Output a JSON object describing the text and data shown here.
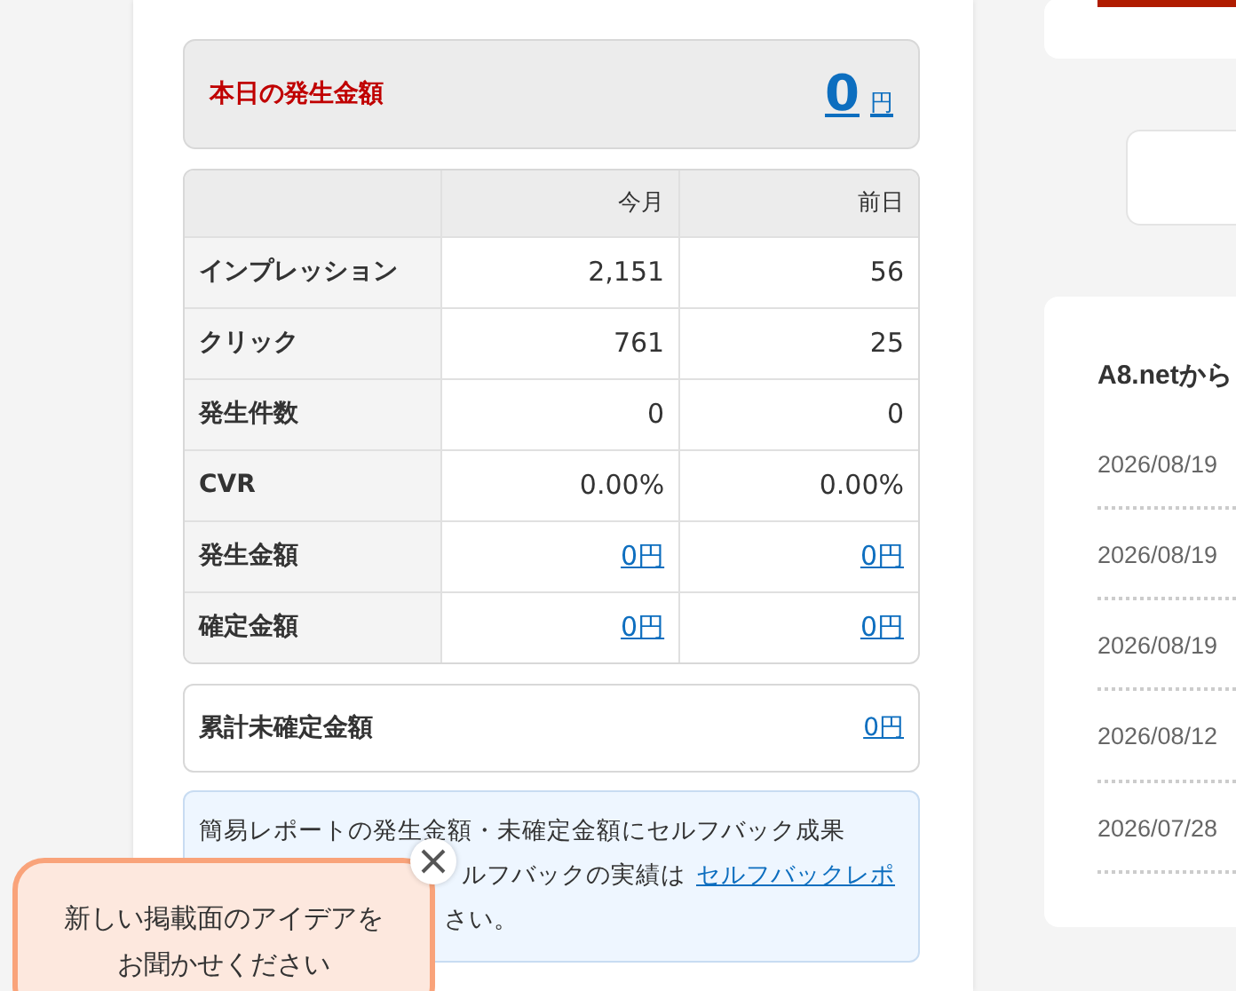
{
  "today": {
    "label": "本日の発生金額",
    "amount": "0",
    "unit": "円"
  },
  "report_table": {
    "columns": [
      "今月",
      "前日"
    ],
    "rows": [
      {
        "label": "インプレッション",
        "kind": "text",
        "values": [
          "2,151",
          "56"
        ]
      },
      {
        "label": "クリック",
        "kind": "text",
        "values": [
          "761",
          "25"
        ]
      },
      {
        "label": "発生件数",
        "kind": "text",
        "values": [
          "0",
          "0"
        ]
      },
      {
        "label": "CVR",
        "kind": "text",
        "values": [
          "0.00%",
          "0.00%"
        ]
      },
      {
        "label": "発生金額",
        "kind": "link",
        "values": [
          "0円",
          "0円"
        ]
      },
      {
        "label": "確定金額",
        "kind": "link",
        "values": [
          "0円",
          "0円"
        ]
      }
    ]
  },
  "unconfirmed_total": {
    "label": "累計未確定金額",
    "value": "0円"
  },
  "notice": {
    "line_1": "簡易レポートの発生金額・未確定金額にセルフバック成果",
    "line_2": "ルフバックの実績は",
    "link": "セルフバックレポ",
    "line_3": "さい。"
  },
  "sidebar": {
    "news_title": "A8.netから",
    "news_dates": [
      "2026/08/19",
      "2026/08/19",
      "2026/08/19",
      "2026/08/12",
      "2026/07/28"
    ]
  },
  "feedback_popup": {
    "lines": [
      "新しい掲載面のアイデアを",
      "お聞かせください"
    ]
  }
}
